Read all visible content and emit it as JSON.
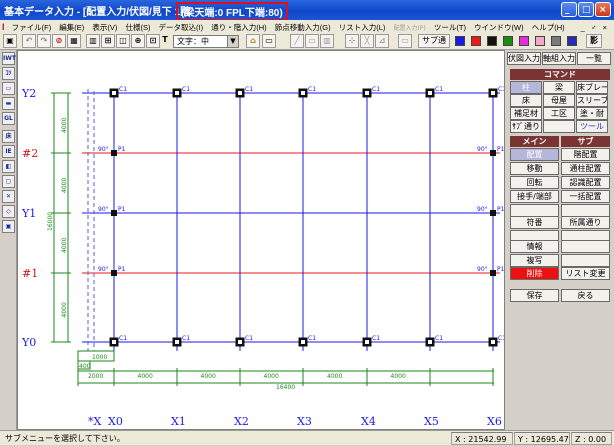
{
  "title": {
    "main": "基本データ入力 - [配置入力/伏図/見下 1階",
    "extra": "(梁天端:0 FPL下端:80)"
  },
  "menu": [
    "ファイル(F)",
    "編集(E)",
    "表示(V)",
    "仕様(S)",
    "データ取込(I)",
    "通り・階入力(H)",
    "節点移動入力(G)",
    "リスト入力(L)",
    "配置入力(P)",
    "ツール(T)",
    "ウインドウ(W)",
    "ヘルプ(H)"
  ],
  "menu_right": "_ ♂ ×",
  "toolbar": {
    "text_combo": "文字：中",
    "sub_toggle": "サブ通",
    "text_label": "T",
    "colors": [
      "#1a1ae8",
      "#e81a1a",
      "#111111",
      "#1a8a1a",
      "#e82ae0",
      "#f2a8c8",
      "#7a7a7a",
      "#2a2ab8"
    ],
    "shadow_label": "影"
  },
  "left_tools": [
    "IWT",
    "ｺｿ",
    "▭",
    "▬",
    "GL",
    "床",
    "IE",
    "◧",
    "▢",
    "✕",
    "◇",
    "▣"
  ],
  "grid": {
    "y_axes": [
      "Y2",
      "#2",
      "Y1",
      "#1",
      "Y0"
    ],
    "x_axes": [
      "*X",
      "X0",
      "X1",
      "X2",
      "X3",
      "X4",
      "X5",
      "X6"
    ],
    "x_dims": [
      "2000",
      "4000",
      "4000",
      "4000",
      "4000",
      "4000"
    ],
    "x_total": "16400",
    "x_small": [
      "1000",
      "400"
    ],
    "y_dims": [
      "4000",
      "4000",
      "4000",
      "4000"
    ],
    "y_total": "16000",
    "col_label": "C1",
    "post_label": "P1",
    "post_prefix": "90°"
  },
  "panel": {
    "top_buttons": [
      "伏図入力",
      "軸組入力",
      "一覧"
    ],
    "command_header": "コマンド",
    "commands": [
      "柱",
      "梁",
      "床ブレース",
      "床",
      "母屋",
      "スリーブ",
      "補足材",
      "工区",
      "塗・耐",
      "ｻﾌﾞ通り",
      "",
      "ツール"
    ],
    "main_header": "メイン",
    "sub_header": "サブ",
    "main_buttons": [
      "配置",
      "移動",
      "回転",
      "接手/端部",
      "",
      "符番",
      "",
      "情報",
      "複写",
      "削除",
      "保存"
    ],
    "sub_buttons": [
      "階配置",
      "通柱配置",
      "認識配置",
      "一括配置",
      "",
      "所属通り",
      "",
      "",
      "",
      "リスト変更",
      "戻る"
    ]
  },
  "status": {
    "message": "サブメニューを選択して下さい。",
    "x": "X : 21542.99",
    "y": "Y : 12695.47",
    "z": "Z : 0.00"
  }
}
